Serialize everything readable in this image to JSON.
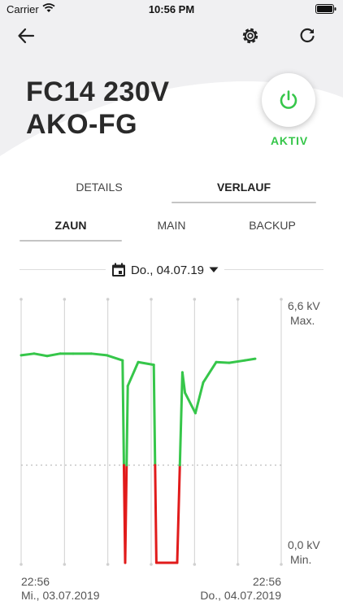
{
  "status_bar": {
    "carrier": "Carrier",
    "time": "10:56 PM"
  },
  "header": {
    "title_line1": "FC14 230V",
    "title_line2": "AKO-FG",
    "status": "AKTIV",
    "icons": [
      "back-arrow-icon",
      "gear-icon",
      "refresh-icon",
      "power-icon"
    ]
  },
  "tabs": [
    {
      "label": "DETAILS",
      "active": false
    },
    {
      "label": "VERLAUF",
      "active": true
    }
  ],
  "subtabs": [
    {
      "label": "ZAUN",
      "active": true
    },
    {
      "label": "MAIN",
      "active": false
    },
    {
      "label": "BACKUP",
      "active": false
    }
  ],
  "date_selector": {
    "label": "Do., 04.07.19"
  },
  "colors": {
    "accent": "#36c64a",
    "line_ok": "#36c64a",
    "line_alarm": "#e11b1b",
    "grid": "#d0d0d0"
  },
  "chart_data": {
    "type": "line",
    "y_max_label": "6,6 kV",
    "y_max_sub": "Max.",
    "y_min_label": "0,0 kV",
    "y_min_sub": "Min.",
    "ylim": [
      0,
      6.6
    ],
    "x_start_time": "22:56",
    "x_start_date": "Mi., 03.07.2019",
    "x_end_time": "22:56",
    "x_end_date": "Do., 04.07.2019",
    "series": [
      {
        "values": [
          [
            0.0,
            6.1
          ],
          [
            0.05,
            6.15
          ],
          [
            0.1,
            6.08
          ],
          [
            0.15,
            6.15
          ],
          [
            0.2,
            6.15
          ],
          [
            0.27,
            6.15
          ],
          [
            0.33,
            6.1
          ],
          [
            0.39,
            5.95
          ],
          [
            0.4,
            0.0
          ],
          [
            0.41,
            5.2
          ],
          [
            0.45,
            5.9
          ],
          [
            0.51,
            5.82
          ],
          [
            0.52,
            0.0
          ],
          [
            0.57,
            0.0
          ],
          [
            0.6,
            0.0
          ],
          [
            0.62,
            5.6
          ],
          [
            0.63,
            5.0
          ],
          [
            0.67,
            4.4
          ],
          [
            0.7,
            5.3
          ],
          [
            0.75,
            5.9
          ],
          [
            0.8,
            5.88
          ],
          [
            0.86,
            5.95
          ],
          [
            0.9,
            6.0
          ]
        ]
      }
    ]
  }
}
